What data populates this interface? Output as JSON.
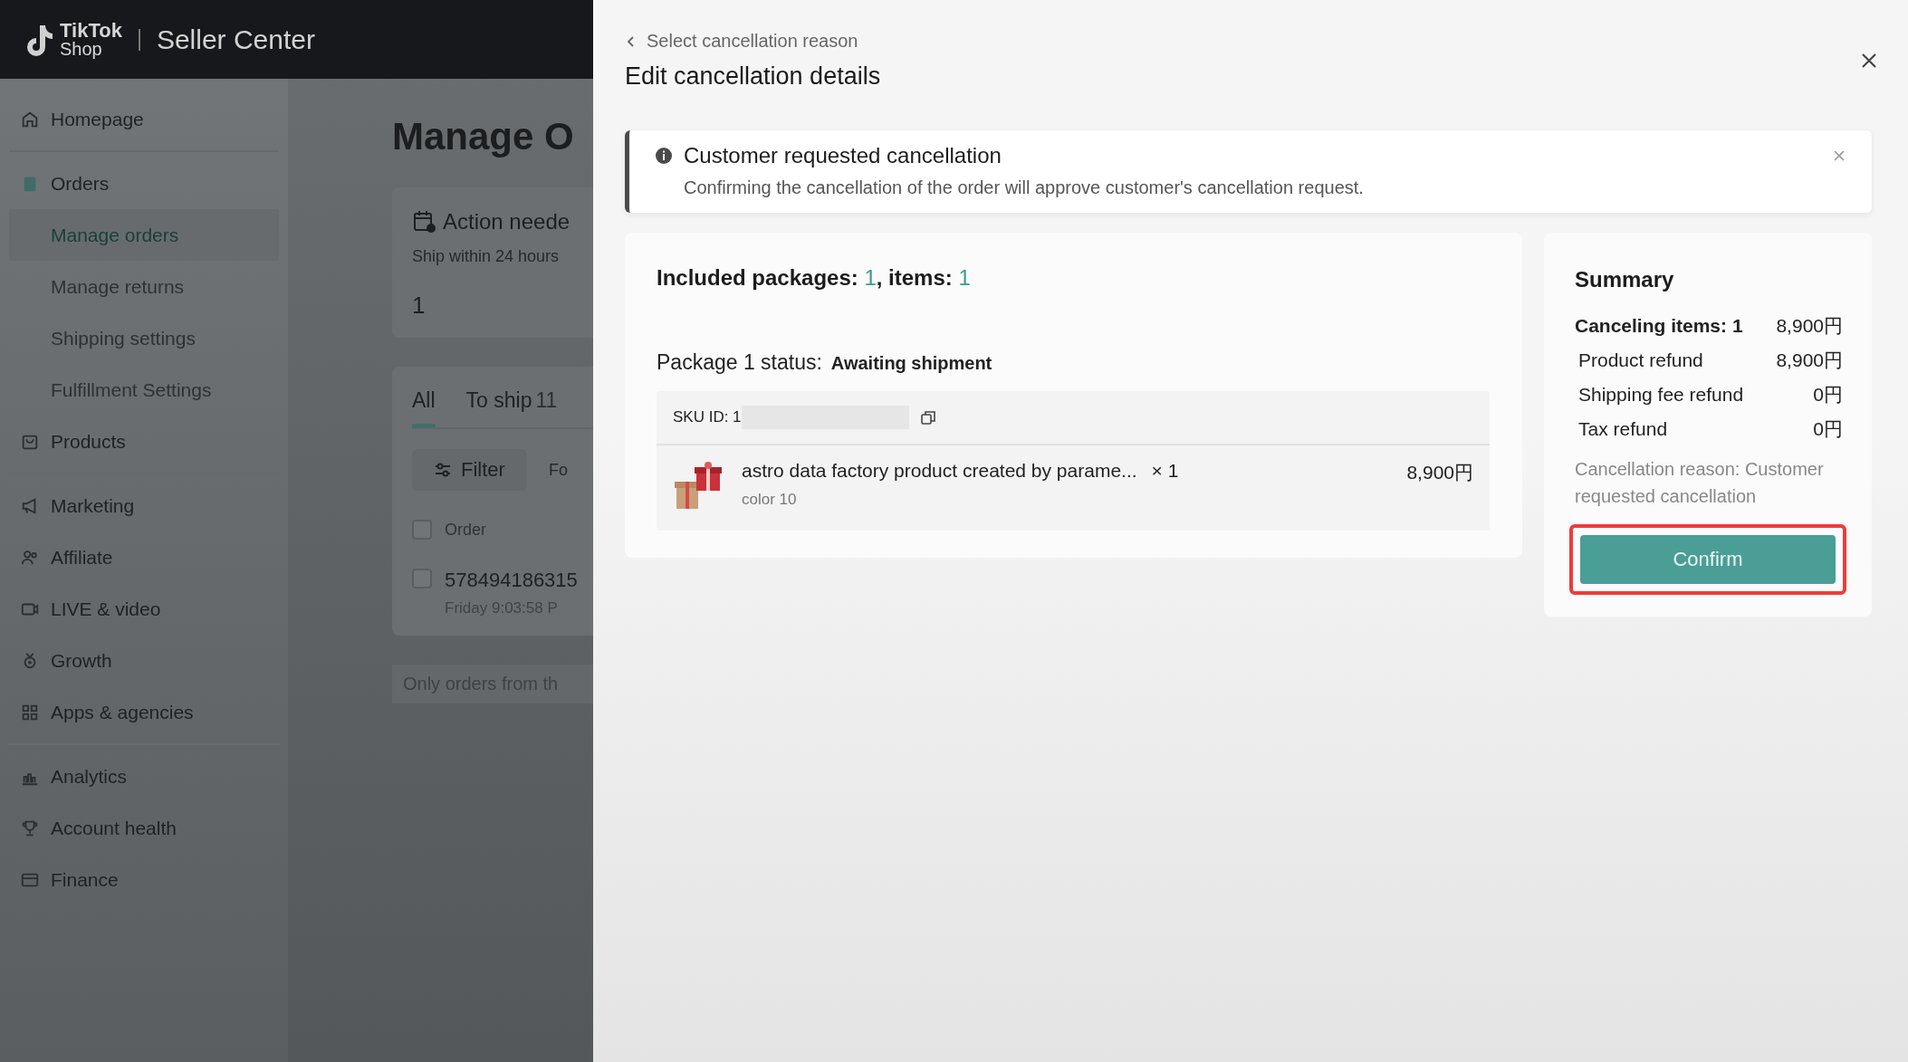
{
  "header": {
    "logo_top": "TikTok",
    "logo_bottom": "Shop",
    "title": "Seller Center"
  },
  "sidebar": {
    "groups": [
      {
        "items": [
          {
            "label": "Homepage",
            "kind": "nav",
            "selected": false
          }
        ]
      },
      {
        "items": [
          {
            "label": "Orders",
            "kind": "nav",
            "selected": false
          },
          {
            "label": "Manage orders",
            "kind": "sub",
            "selected": true
          },
          {
            "label": "Manage returns",
            "kind": "sub",
            "selected": false
          },
          {
            "label": "Shipping settings",
            "kind": "sub",
            "selected": false
          },
          {
            "label": "Fulfillment Settings",
            "kind": "sub",
            "selected": false
          },
          {
            "label": "Products",
            "kind": "nav",
            "selected": false
          }
        ]
      },
      {
        "items": [
          {
            "label": "Marketing",
            "kind": "nav",
            "selected": false
          },
          {
            "label": "Affiliate",
            "kind": "nav",
            "selected": false
          },
          {
            "label": "LIVE & video",
            "kind": "nav",
            "selected": false
          },
          {
            "label": "Growth",
            "kind": "nav",
            "selected": false
          },
          {
            "label": "Apps & agencies",
            "kind": "nav",
            "selected": false
          }
        ]
      },
      {
        "items": [
          {
            "label": "Analytics",
            "kind": "nav",
            "selected": false
          },
          {
            "label": "Account health",
            "kind": "nav",
            "selected": false
          },
          {
            "label": "Finance",
            "kind": "nav",
            "selected": false
          }
        ]
      }
    ]
  },
  "page": {
    "title": "Manage O",
    "action_card": {
      "title": "Action neede",
      "subtitle": "Ship within 24 hours",
      "count": "1"
    },
    "tabs": [
      {
        "label": "All",
        "selected": true
      },
      {
        "label": "To ship",
        "count": "11",
        "selected": false
      }
    ],
    "filter_button": "Filter",
    "filter_extra": "Fo",
    "column_header": "Order",
    "header_checked": false,
    "order": {
      "id": "578494186315",
      "time": "Friday 9:03:58 P",
      "checked": false
    },
    "footer_note": "Only orders from th"
  },
  "drawer": {
    "back_link": "Select cancellation reason",
    "title": "Edit cancellation details",
    "notice": {
      "title": "Customer requested cancellation",
      "text": "Confirming the cancellation of the order will approve customer's cancellation request."
    },
    "packages": {
      "packages_label": "Included packages: ",
      "packages_count": "1",
      "items_label": ", items: ",
      "items_count": "1",
      "status_label": "Package 1 status:",
      "status": "Awaiting shipment",
      "sku_label": "SKU ID: 1",
      "product": {
        "name": "astro data factory product created by parame...",
        "quantity": "× 1",
        "variant": "color 10",
        "price": "8,900円"
      }
    },
    "summary": {
      "title": "Summary",
      "rows": [
        {
          "label": "Canceling items: 1",
          "value": "8,900円",
          "kind": "total"
        },
        {
          "label": "Product refund",
          "value": "8,900円",
          "kind": "line"
        },
        {
          "label": "Shipping fee refund",
          "value": "0円",
          "kind": "line"
        },
        {
          "label": "Tax refund",
          "value": "0円",
          "kind": "line"
        }
      ],
      "reason": "Cancellation reason: Customer requested cancellation",
      "confirm_button": {
        "label": "Confirm",
        "highlighted": true
      }
    }
  }
}
